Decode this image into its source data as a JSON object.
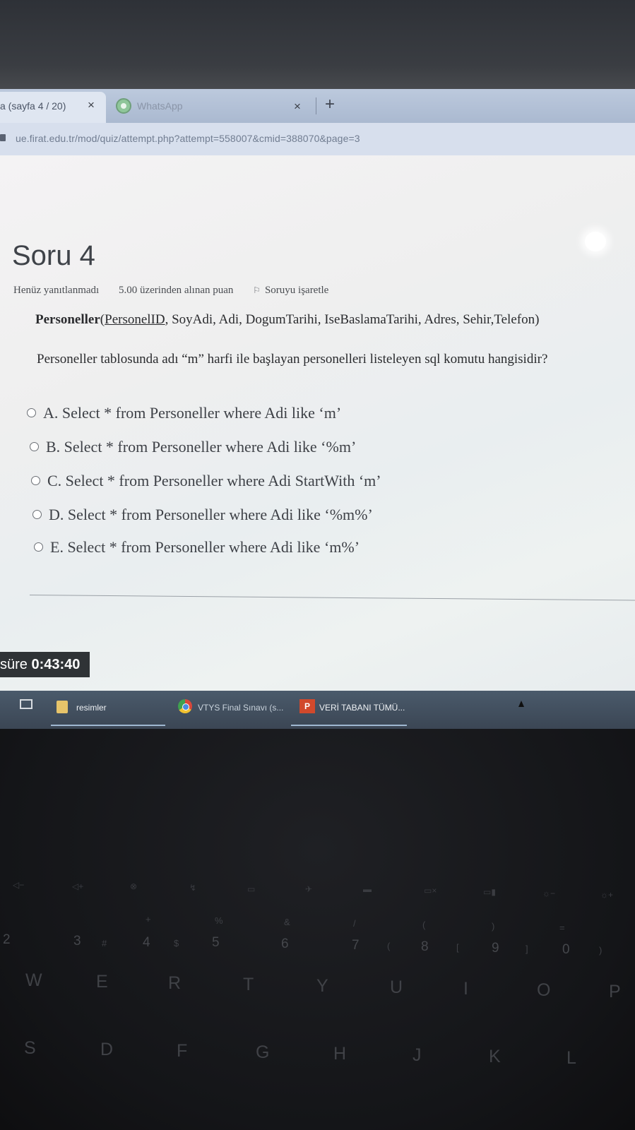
{
  "browser": {
    "tabs": [
      {
        "title": "a (sayfa 4 / 20)",
        "close": "×",
        "active": true
      },
      {
        "title": "WhatsApp",
        "close": "×",
        "icon": "whatsapp-icon",
        "active": false
      }
    ],
    "new_tab": "+",
    "url": "ue.firat.edu.tr/mod/quiz/attempt.php?attempt=558007&cmid=388070&page=3"
  },
  "question": {
    "title": "Soru 4",
    "status": "Henüz yanıtlanmadı",
    "points": "5.00 üzerinden alınan puan",
    "flag_label": "Soruyu işaretle",
    "schema_table": "Personeller",
    "schema_open": "(",
    "schema_pk": "PersonelID",
    "schema_rest": ", SoyAdi, Adi, DogumTarihi, IseBaslamaTarihi, Adres, Sehir,Telefon)",
    "text": "Personeller tablosunda adı “m” harfi ile başlayan personelleri listeleyen sql komutu hangisidir?",
    "options": [
      "A. Select * from Personeller where Adi like ‘m’",
      "B. Select * from Personeller where Adi like ‘%m’",
      "C. Select * from Personeller where Adi StartWith ‘m’",
      "D. Select * from Personeller where Adi like ‘%m%’",
      "E. Select * from Personeller where Adi like ‘m%’"
    ]
  },
  "timer": {
    "label": "süre ",
    "value": "0:43:40"
  },
  "taskbar": {
    "items": [
      {
        "label": "resimler",
        "icon": "folder-icon"
      },
      {
        "label": "VTYS Final Sınavı (s...",
        "icon": "chrome-icon"
      },
      {
        "label": "VERİ TABANI TÜMÜ...",
        "icon": "powerpoint-icon"
      }
    ]
  },
  "keyboard": {
    "number_row": [
      "2",
      "3",
      "4",
      "5",
      "6",
      "7",
      "8",
      "9",
      "0"
    ],
    "symbols": [
      "#",
      "$",
      "%",
      "&",
      "/",
      "(",
      ")",
      "="
    ],
    "brackets": [
      "(",
      "[",
      "]",
      ")"
    ],
    "top_letters": [
      "W",
      "E",
      "R",
      "T",
      "Y",
      "U",
      "I",
      "O",
      "P"
    ],
    "home_letters": [
      "S",
      "D",
      "F",
      "G",
      "H",
      "J",
      "K",
      "L"
    ]
  }
}
